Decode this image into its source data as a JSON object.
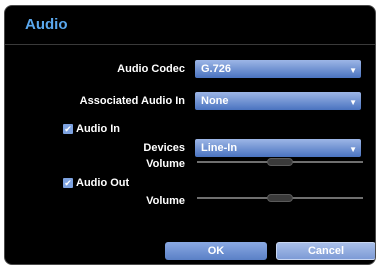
{
  "dialog": {
    "title": "Audio",
    "audio_codec": {
      "label": "Audio Codec",
      "value": "G.726"
    },
    "associated_audio_in": {
      "label": "Associated Audio In",
      "value": "None"
    },
    "audio_in": {
      "checkbox_label": "Audio In",
      "checked": true,
      "devices": {
        "label": "Devices",
        "value": "Line-In"
      },
      "volume": {
        "label": "Volume",
        "level": 0.5
      }
    },
    "audio_out": {
      "checkbox_label": "Audio Out",
      "checked": true,
      "volume": {
        "label": "Volume",
        "level": 0.5
      }
    },
    "buttons": {
      "ok": "OK",
      "cancel": "Cancel"
    }
  },
  "icons": {
    "dropdown": "chevron-down-icon",
    "check": "checkmark-icon"
  },
  "colors": {
    "title": "#5aa8ee",
    "combo": "#4a73c0",
    "background": "#000000"
  }
}
